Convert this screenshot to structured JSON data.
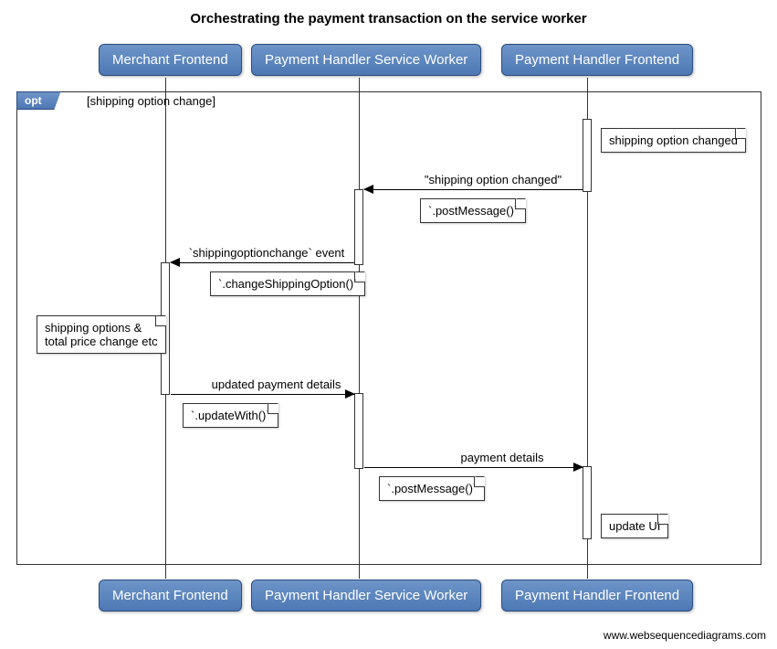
{
  "title": "Orchestrating the payment transaction on the service worker",
  "participants": {
    "merchant": "Merchant Frontend",
    "sw": "Payment Handler Service Worker",
    "frontend": "Payment Handler Frontend"
  },
  "opt": {
    "label": "opt",
    "condition": "[shipping option change]"
  },
  "notes": {
    "shipping_changed": "shipping option changed",
    "post_msg1": "`.postMessage()`",
    "change_shipping": "`.changeShippingOption()`",
    "options_price": "shipping options &\ntotal price change etc",
    "update_with": "`.updateWith()`",
    "post_msg2": "`.postMessage()`",
    "update_ui": "update UI"
  },
  "messages": {
    "msg1": "\"shipping option changed\"",
    "msg2": "`shippingoptionchange` event",
    "msg3": "updated payment details",
    "msg4": "payment details"
  },
  "watermark": "www.websequencediagrams.com",
  "chart_data": {
    "type": "sequence-diagram",
    "title": "Orchestrating the payment transaction on the service worker",
    "participants": [
      "Merchant Frontend",
      "Payment Handler Service Worker",
      "Payment Handler Frontend"
    ],
    "fragments": [
      {
        "type": "opt",
        "condition": "shipping option change",
        "steps": [
          {
            "type": "note",
            "over": "Payment Handler Frontend",
            "text": "shipping option changed"
          },
          {
            "type": "message",
            "from": "Payment Handler Frontend",
            "to": "Payment Handler Service Worker",
            "label": "\"shipping option changed\"",
            "note": ".postMessage()"
          },
          {
            "type": "message",
            "from": "Payment Handler Service Worker",
            "to": "Merchant Frontend",
            "label": "`shippingoptionchange` event",
            "note": ".changeShippingOption()"
          },
          {
            "type": "note",
            "over": "Merchant Frontend",
            "text": "shipping options & total price change etc"
          },
          {
            "type": "message",
            "from": "Merchant Frontend",
            "to": "Payment Handler Service Worker",
            "label": "updated payment details",
            "note": ".updateWith()"
          },
          {
            "type": "message",
            "from": "Payment Handler Service Worker",
            "to": "Payment Handler Frontend",
            "label": "payment details",
            "note": ".postMessage()"
          },
          {
            "type": "note",
            "over": "Payment Handler Frontend",
            "text": "update UI"
          }
        ]
      }
    ]
  }
}
